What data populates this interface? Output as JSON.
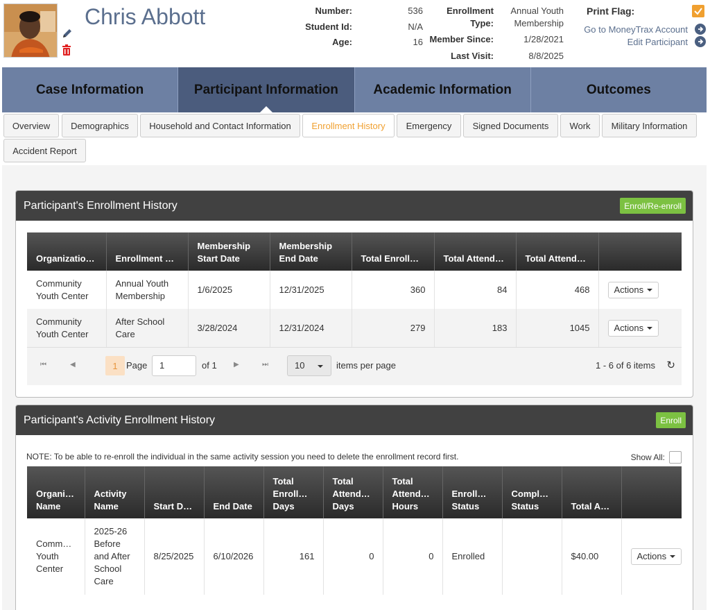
{
  "participant": {
    "name": "Chris Abbott",
    "number_label": "Number:",
    "number": "536",
    "student_id_label": "Student Id:",
    "student_id": "N/A",
    "age_label": "Age:",
    "age": "16",
    "enrollment_type_label_1": "Enrollment",
    "enrollment_type_label_2": "Type:",
    "enrollment_type_1": "Annual Youth",
    "enrollment_type_2": "Membership",
    "member_since_label": "Member Since:",
    "member_since": "1/28/2021",
    "last_visit_label": "Last Visit:",
    "last_visit": "8/8/2025",
    "print_flag_label": "Print Flag:",
    "links": [
      "Go to MoneyTrax Account",
      "Edit Participant"
    ]
  },
  "main_tabs": [
    "Case Information",
    "Participant Information",
    "Academic Information",
    "Outcomes"
  ],
  "sub_tabs": [
    "Overview",
    "Demographics",
    "Household and Contact Information",
    "Enrollment History",
    "Emergency",
    "Signed Documents",
    "Work",
    "Military Information",
    "Accident Report"
  ],
  "enrollment_history": {
    "title": "Participant's Enrollment History",
    "button": "Enroll/Re-enroll",
    "headers": [
      [
        "Organization…"
      ],
      [
        "Enrollment T…"
      ],
      [
        "Membership",
        "Start Date"
      ],
      [
        "Membership",
        "End Date"
      ],
      [
        "Total Enrollm…"
      ],
      [
        "Total Attenda…"
      ],
      [
        "Total Attenda…"
      ],
      [
        ""
      ]
    ],
    "rows": [
      {
        "org": [
          "Community",
          "Youth Center"
        ],
        "type": [
          "Annual Youth",
          "Membership"
        ],
        "start": "1/6/2025",
        "end": "12/31/2025",
        "enroll_days": "360",
        "attend_days": "84",
        "attend_hours": "468",
        "action": "Actions"
      },
      {
        "org": [
          "Community",
          "Youth Center"
        ],
        "type": [
          "After School",
          "Care"
        ],
        "start": "3/28/2024",
        "end": "12/31/2024",
        "enroll_days": "279",
        "attend_days": "183",
        "attend_hours": "1045",
        "action": "Actions"
      }
    ],
    "pager": {
      "current": "1",
      "page_label": "Page",
      "page_value": "1",
      "of_label": "of 1",
      "per_page": "10",
      "per_page_label": "items per page",
      "summary": "1 - 6 of 6 items"
    }
  },
  "activity_history": {
    "title": "Participant's Activity Enrollment History",
    "button": "Enroll",
    "note": "NOTE: To be able to re-enroll the individual in the same activity session you need to delete the enrollment record first.",
    "show_all_label": "Show All:",
    "headers": [
      [
        "Organi…",
        "Name"
      ],
      [
        "Activity",
        "Name"
      ],
      [
        "Start Date"
      ],
      [
        "End Date"
      ],
      [
        "Total",
        "Enrollm…",
        "Days"
      ],
      [
        "Total",
        "Attenda…",
        "Days"
      ],
      [
        "Total",
        "Attenda…",
        "Hours"
      ],
      [
        "Enrollm…",
        "Status"
      ],
      [
        "Comple…",
        "Status"
      ],
      [
        "Total Ac…"
      ],
      [
        ""
      ]
    ],
    "rows": [
      {
        "org": [
          "Comm…",
          "Youth",
          "Center"
        ],
        "activity": [
          "2025-26",
          "Before",
          "and After",
          "School",
          "Care"
        ],
        "start": "8/25/2025",
        "end": "6/10/2026",
        "enroll_days": "161",
        "attend_days": "0",
        "attend_hours": "0",
        "status": "Enrolled",
        "completion": "",
        "total": "$40.00",
        "action": "Actions"
      }
    ]
  },
  "colors": {
    "accent": "#f0a030",
    "green": "#7cc142",
    "nav": "#6d80a3",
    "nav_active": "#4b5c7d",
    "title_bar": "#414141"
  }
}
